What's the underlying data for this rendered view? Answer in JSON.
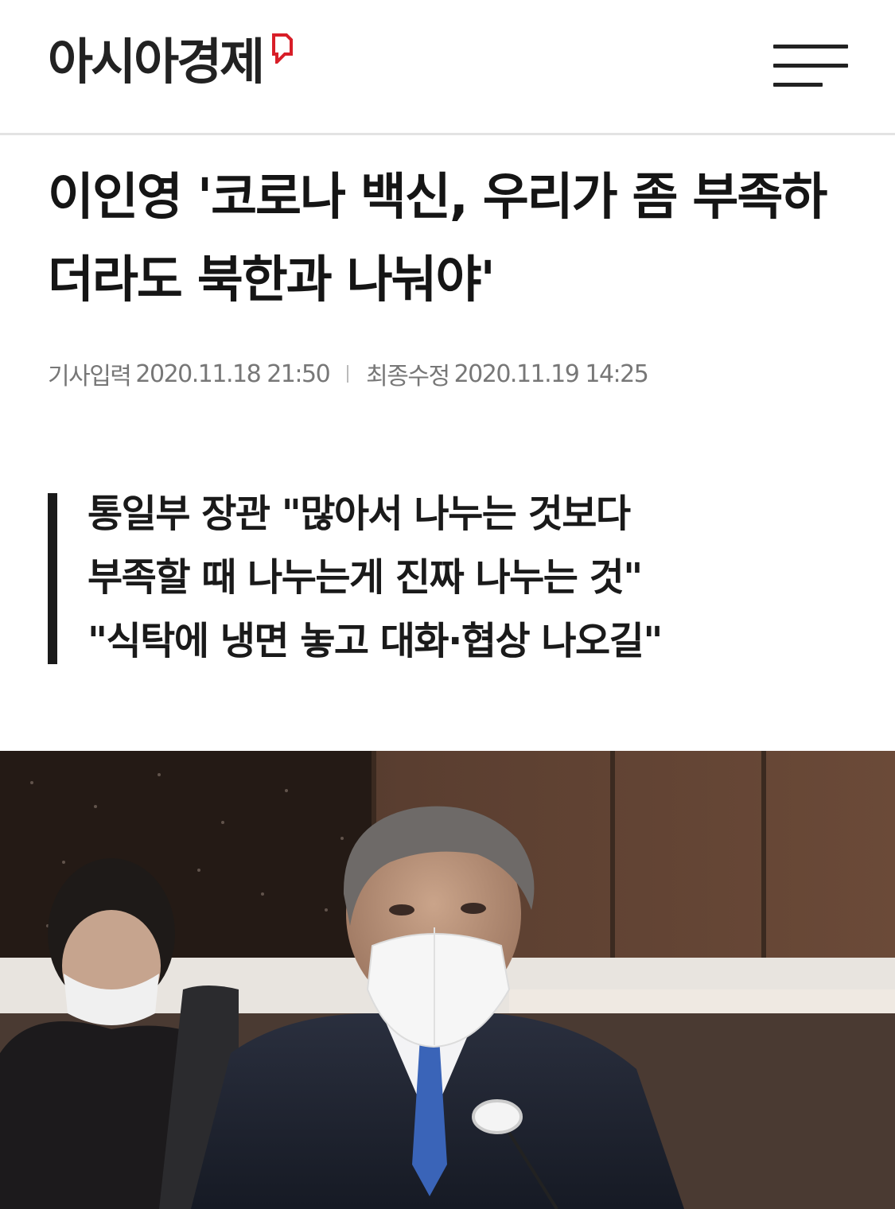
{
  "header": {
    "logo_text": "아시아경제",
    "brand_color": "#d81e28",
    "menu_icon": "hamburger-menu-icon"
  },
  "article": {
    "headline": "이인영 '코로나 백신, 우리가 좀 부족하더라도 북한과 나눠야'",
    "published_label": "기사입력",
    "published_value": "2020.11.18 21:50",
    "modified_label": "최종수정",
    "modified_value": "2020.11.19 14:25",
    "subtitle_lines": [
      "통일부 장관 \"많아서 나누는 것보다",
      "부족할 때 나누는게 진짜 나누는 것\"",
      "\"식탁에 냉면 놓고 대화·협상 나오길\""
    ]
  }
}
